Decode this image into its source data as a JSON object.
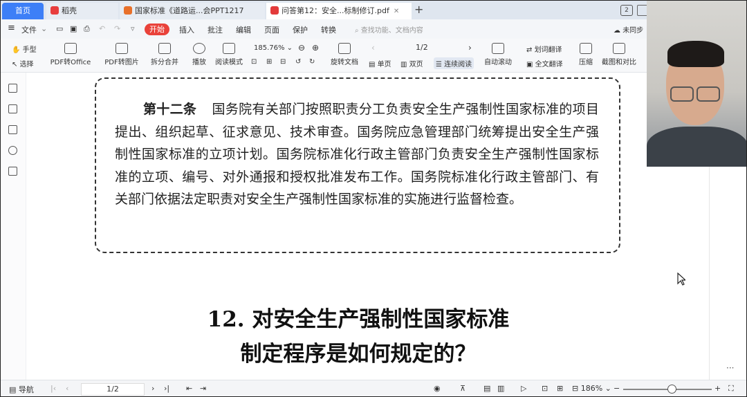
{
  "tabs": [
    {
      "label": "首页",
      "active": false
    },
    {
      "label": "稻壳",
      "active": false
    },
    {
      "label": "国家标准《道路运...会PPT1217",
      "active": false
    },
    {
      "label": "问答第12：安全...标制修订.pdf",
      "active": true
    }
  ],
  "window_badge": "2",
  "menu": {
    "file": "文件",
    "start": "开始",
    "items": [
      "插入",
      "批注",
      "编辑",
      "页面",
      "保护",
      "转换"
    ],
    "search_placeholder": "查找功能、文档内容",
    "sync": "未同步"
  },
  "toolbar": {
    "hand": "手型",
    "select": "选择",
    "pdf_to_office": "PDF转Office",
    "pdf_to_image": "PDF转图片",
    "split_merge": "拆分合并",
    "play": "播放",
    "read_mode": "阅读模式",
    "zoom": "185.76%",
    "rotate_doc": "旋转文档",
    "page_indicator": "1/2",
    "single_page": "单页",
    "double_page": "双页",
    "continuous_read": "连续阅读",
    "auto_scroll": "自动滚动",
    "translate": "划词翻译",
    "full_translate": "全文翻译",
    "compress": "压缩",
    "screenshot_compare": "截图和对比"
  },
  "document": {
    "article_label": "第十二条",
    "article_text": "国务院有关部门按照职责分工负责安全生产强制性国家标准的项目提出、组织起草、征求意见、技术审查。国务院应急管理部门统筹提出安全生产强制性国家标准的立项计划。国务院标准化行政主管部门负责安全生产强制性国家标准的立项、编号、对外通报和授权批准发布工作。国务院标准化行政主管部门、有关部门依据法定职责对安全生产强制性国家标准的实施进行监督检查。",
    "heading_line1": "12. 对安全生产强制性国家标准",
    "heading_line2": "制定程序是如何规定的？"
  },
  "status": {
    "nav": "导航",
    "page": "1/2",
    "zoom": "186%",
    "more": "···"
  }
}
